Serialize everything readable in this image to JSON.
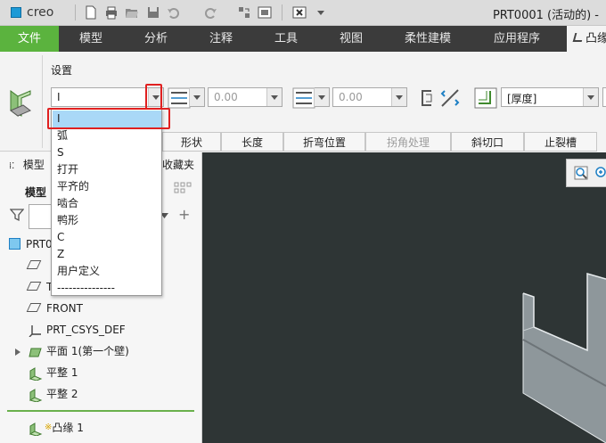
{
  "titlebar": {
    "logo_text": "creo",
    "window_title": "PRT0001 (活动的) -",
    "quick_access": [
      "new-icon",
      "print-icon",
      "open-icon",
      "save-icon",
      "undo-icon",
      "redo-icon",
      "regenerate-icon",
      "windows-icon",
      "close-window-icon",
      "customize-icon"
    ]
  },
  "tabs": [
    "文件",
    "模型",
    "分析",
    "注释",
    "工具",
    "视图",
    "柔性建模",
    "应用程序",
    "凸缘"
  ],
  "ribbon": {
    "settings_label": "设置",
    "shape_combo_value": "I",
    "length1_value": "0.00",
    "length2_value": "0.00",
    "thickness_value": "[厚度]"
  },
  "dropdown": {
    "items": [
      "I",
      "弧",
      "S",
      "打开",
      "平齐的",
      "啮合",
      "鸭形",
      "C",
      "Z",
      "用户定义",
      "---------------"
    ],
    "selected": "I"
  },
  "subtabs": [
    "形状",
    "长度",
    "折弯位置",
    "拐角处理",
    "斜切口",
    "止裂槽"
  ],
  "leftpanel": {
    "model_tree_tab": "模型",
    "favorites_tab": "收藏夹",
    "model_tree_title": "模型",
    "tree": [
      {
        "label": "PRT0",
        "icon": "part-icon"
      },
      {
        "label": "",
        "icon": "datum-plane-icon"
      },
      {
        "label": "T",
        "icon": "datum-plane-icon"
      },
      {
        "label": "FRONT",
        "icon": "datum-plane-icon"
      },
      {
        "label": "PRT_CSYS_DEF",
        "icon": "csys-icon"
      },
      {
        "label": "平面 1(第一个壁)",
        "icon": "planar-wall-icon"
      },
      {
        "label": "平整 1",
        "icon": "flat-wall-icon"
      },
      {
        "label": "平整 2",
        "icon": "flat-wall-icon"
      },
      {
        "label": "凸缘 1",
        "icon": "flange-icon"
      }
    ],
    "insert_marker": "※"
  },
  "colors": {
    "file_tab": "#5bb33e",
    "tab_bar": "#3b3b3b",
    "viewport": "#2e3535",
    "highlight": "#e02020",
    "selected_item": "#a9d8f7"
  }
}
